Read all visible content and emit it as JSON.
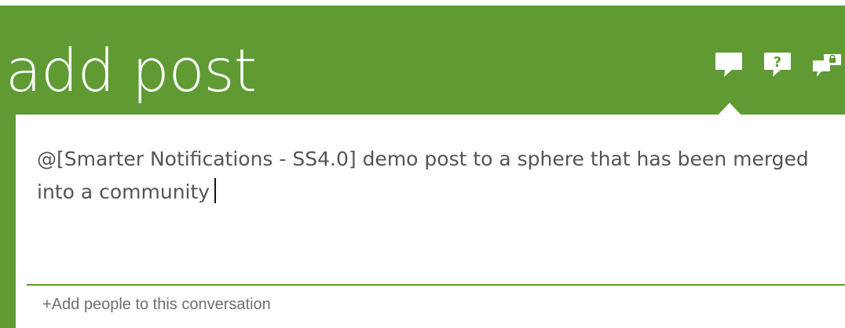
{
  "header": {
    "title": "add post",
    "icons": [
      {
        "name": "post-icon",
        "glyph": ""
      },
      {
        "name": "question-icon",
        "glyph": "?"
      },
      {
        "name": "private-message-icon",
        "glyph": ""
      }
    ]
  },
  "compose": {
    "text": "@[Smarter Notifications - SS4.0]  demo post to a sphere that has been merged into a community",
    "add_people_label": "+Add people to this conversation"
  },
  "colors": {
    "accent": "#5f9b32",
    "text": "#545454",
    "muted_text": "#6f6f6f",
    "background": "#ffffff"
  }
}
